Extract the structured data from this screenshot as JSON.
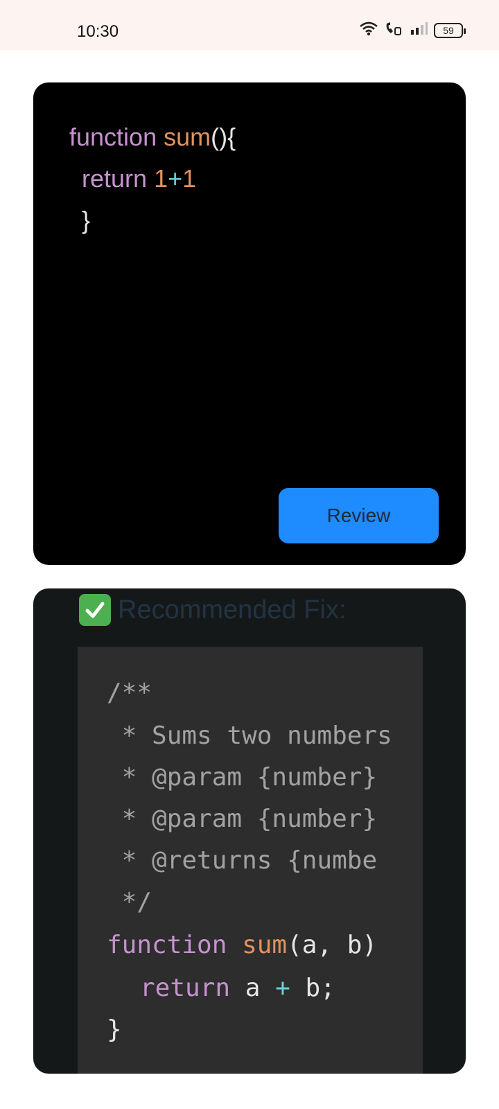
{
  "status_bar": {
    "time": "10:30",
    "battery": "59",
    "icons": [
      "wifi-icon",
      "volte-call-icon",
      "signal-icon",
      "battery-icon"
    ]
  },
  "editor": {
    "line1": {
      "kw": "function",
      "fn": "sum",
      "punct": "(){"
    },
    "line2": {
      "kw": "return",
      "num1": "1",
      "op": "+",
      "num2": "1"
    },
    "line3": {
      "punct": "}"
    },
    "review_label": "Review"
  },
  "result": {
    "icon": "check-mark-icon",
    "title": "Recommended Fix:",
    "code": {
      "c1": "/**",
      "c2": " * Sums two numbers",
      "c3": " * @param {number}",
      "c4": " * @param {number}",
      "c5": " * @returns {numbe",
      "c6": " */",
      "l7_kw": "function",
      "l7_fn": "sum",
      "l7_rest": "(a, b)",
      "l8_kw": "return",
      "l8_a": "a",
      "l8_op": "+",
      "l8_b": "b;",
      "l9": "}"
    }
  },
  "colors": {
    "keyword": "#c692cf",
    "function_name": "#e2925e",
    "operator": "#6ccfd7",
    "comment": "#a2a2a2",
    "button": "#1e8bff",
    "check": "#4caf50"
  }
}
